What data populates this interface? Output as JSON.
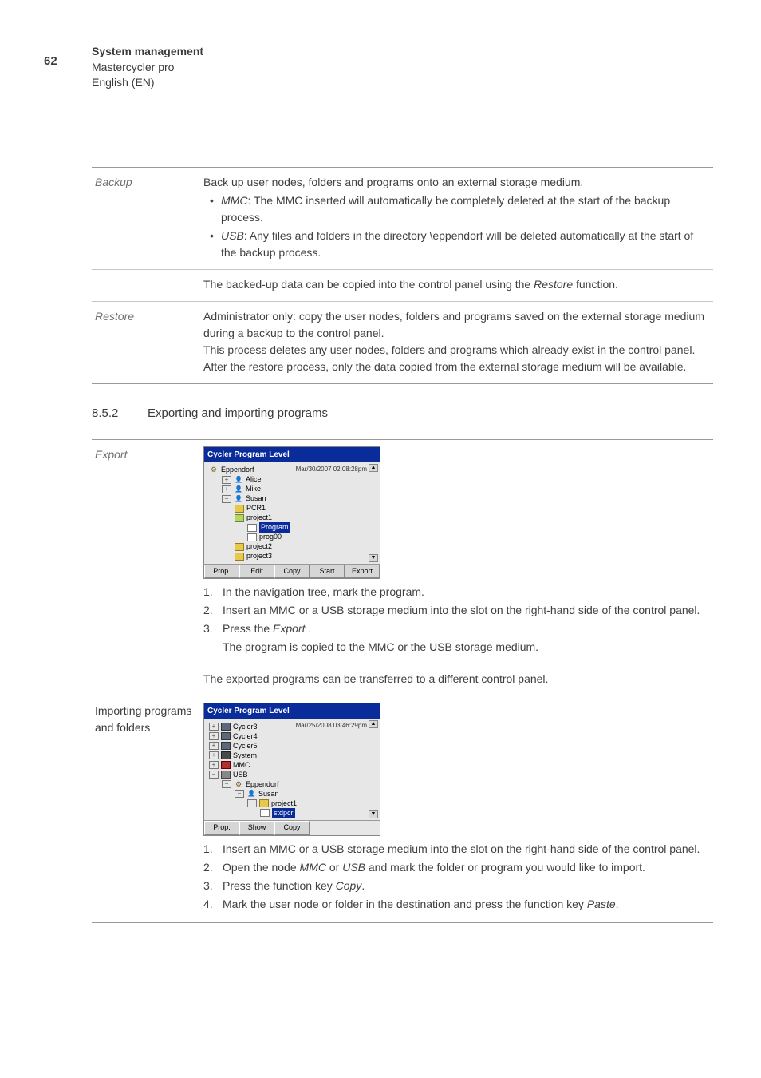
{
  "page_number": "62",
  "header": {
    "l1": "System management",
    "l2": "Mastercycler pro",
    "l3": "English (EN)"
  },
  "t1": {
    "backup_label": "Backup",
    "backup_p1": "Back up user nodes, folders and programs onto an external storage medium.",
    "backup_b1_em": "MMC",
    "backup_b1": ": The MMC inserted will automatically be completely deleted at the start of the backup process.",
    "backup_b2_em": "USB",
    "backup_b2": ": Any files and folders in the directory \\eppendorf will be deleted automatically at the start of the backup process.",
    "backup_p2a": "The backed-up data can be copied into the control panel using the ",
    "backup_p2_em": "Restore",
    "backup_p2b": " function.",
    "restore_label": "Restore",
    "restore_p": "Administrator only: copy the user nodes, folders and programs saved on the external storage medium during a backup to the control panel.\nThis process deletes any user nodes, folders and programs which already exist in the control panel. After the restore process, only the data copied from the external storage medium will be available."
  },
  "section": {
    "num": "8.5.2",
    "title": "Exporting and importing programs"
  },
  "t2": {
    "export_label": "Export",
    "shot1": {
      "title": "Cycler Program Level",
      "stamp": "Mar/30/2007 02:08:28pm",
      "root": "Eppendorf",
      "u1": "Alice",
      "u2": "Mike",
      "u3": "Susan",
      "f_pcr1": "PCR1",
      "f_proj1": "project1",
      "d_prog": "Program",
      "d_prog00": "prog00",
      "f_proj2": "project2",
      "f_proj3": "project3",
      "btns": [
        "Prop.",
        "Edit",
        "Copy",
        "Start",
        "Export"
      ]
    },
    "exp1": "In the navigation tree, mark the program.",
    "exp2": "Insert an MMC or a USB storage medium into the slot on the right-hand side of the control panel.",
    "exp3a": "Press the ",
    "exp3_em": "Export",
    "exp3b": " .",
    "exp3_sub": "The program is copied to the MMC or the USB storage medium.",
    "exp_note": "The exported programs can be transferred to a different control panel.",
    "import_label": "Importing programs and folders",
    "shot2": {
      "title": "Cycler Program Level",
      "stamp": "Mar/25/2008 03:46:29pm",
      "c3": "Cycler3",
      "c4": "Cycler4",
      "c5": "Cycler5",
      "sys": "System",
      "mmc": "MMC",
      "usb": "USB",
      "root": "Eppendorf",
      "u": "Susan",
      "f": "project1",
      "d": "stdpcr",
      "btns": [
        "Prop.",
        "Show",
        "Copy"
      ]
    },
    "imp1": "Insert an MMC or a USB storage medium into the slot on the right-hand side of the control panel.",
    "imp2a": "Open the node ",
    "imp2_em1": "MMC",
    "imp2b": " or ",
    "imp2_em2": "USB",
    "imp2c": " and mark the folder or program you would like to import.",
    "imp3a": "Press the function key ",
    "imp3_em": "Copy",
    "imp3b": ".",
    "imp4a": "Mark the user node or folder in the destination and press the function key ",
    "imp4_em": "Paste",
    "imp4b": "."
  }
}
